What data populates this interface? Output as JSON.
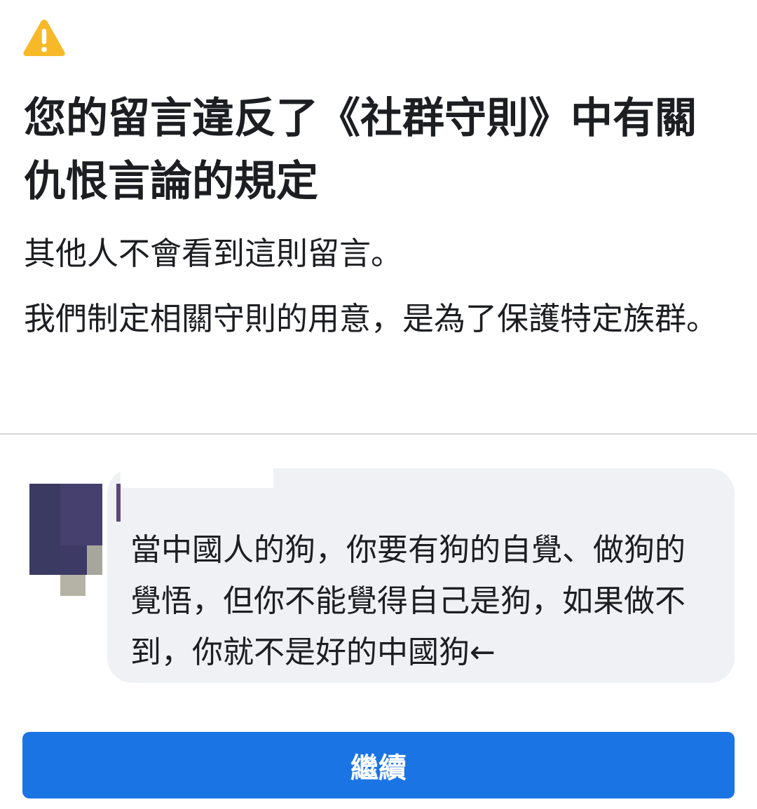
{
  "alert": {
    "icon": "warning-icon",
    "icon_color": "#f7b928",
    "title": "您的留言違反了《社群守則》中有關仇恨言論的規定",
    "subtitle": "其他人不會看到這則留言。",
    "reason": "我們制定相關守則的用意，是為了保護特定族群。"
  },
  "comment": {
    "avatar_icon": "avatar-icon",
    "author_name_redacted": true,
    "text": "當中國人的狗，你要有狗的自覺、做狗的覺悟，但你不能覺得自己是狗，如果做不到，你就不是好的中國狗←"
  },
  "actions": {
    "continue_label": "繼續",
    "continue_color": "#1b74e4"
  }
}
